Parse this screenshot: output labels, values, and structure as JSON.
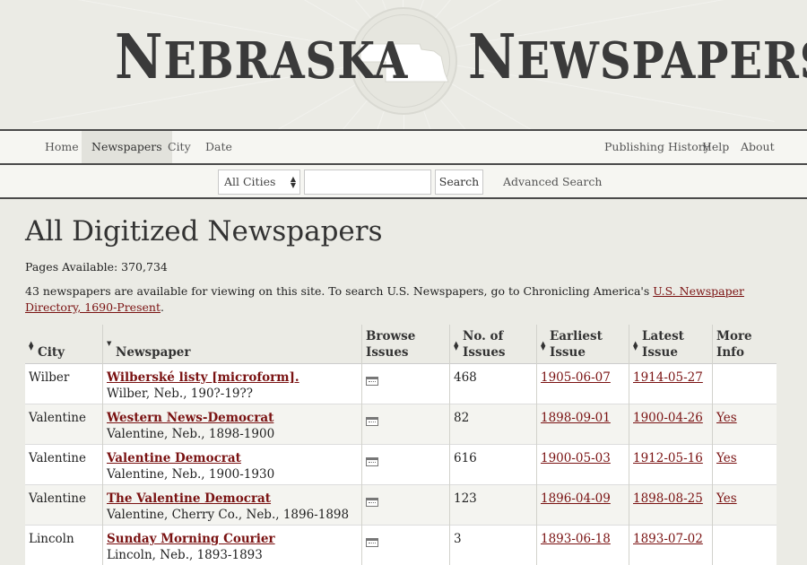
{
  "header": {
    "title_left_initial": "N",
    "title_left_rest": "EBRASKA",
    "title_right_initial": "N",
    "title_right_rest": "EWSPAPERS"
  },
  "nav": {
    "left": [
      "Home",
      "Newspapers",
      "City",
      "Date"
    ],
    "right": [
      "Publishing History",
      "Help",
      "About"
    ],
    "active": "Newspapers"
  },
  "search": {
    "city_select": "All Cities",
    "input_value": "",
    "button_label": "Search",
    "advanced_label": "Advanced Search"
  },
  "page": {
    "heading": "All Digitized Newspapers",
    "pages_available": "Pages Available: 370,734",
    "intro_text": "43 newspapers are available for viewing on this site. To search U.S. Newspapers, go to Chronicling America's ",
    "intro_link": "U.S. Newspaper Directory, 1690-Present",
    "intro_end": "."
  },
  "table": {
    "headers": {
      "city": "City",
      "newspaper": "Newspaper",
      "browse_1": "Browse",
      "browse_2": "Issues",
      "issues_1": "No. of",
      "issues_2": "Issues",
      "earliest_1": "Earliest",
      "earliest_2": "Issue",
      "latest_1": "Latest",
      "latest_2": "Issue",
      "more_1": "More",
      "more_2": "Info"
    },
    "rows": [
      {
        "city": "Wilber",
        "title": "Wilberské listy [microform].",
        "place": "Wilber, Neb., 190?-19??",
        "issues": "468",
        "earliest": "1905-06-07",
        "latest": "1914-05-27",
        "more": ""
      },
      {
        "city": "Valentine",
        "title": "Western News-Democrat",
        "place": "Valentine, Neb., 1898-1900",
        "issues": "82",
        "earliest": "1898-09-01",
        "latest": "1900-04-26",
        "more": "Yes"
      },
      {
        "city": "Valentine",
        "title": "Valentine Democrat",
        "place": "Valentine, Neb., 1900-1930",
        "issues": "616",
        "earliest": "1900-05-03",
        "latest": "1912-05-16",
        "more": "Yes"
      },
      {
        "city": "Valentine",
        "title": "The Valentine Democrat",
        "place": "Valentine, Cherry Co., Neb., 1896-1898",
        "issues": "123",
        "earliest": "1896-04-09",
        "latest": "1898-08-25",
        "more": "Yes"
      },
      {
        "city": "Lincoln",
        "title": "Sunday Morning Courier",
        "place": "Lincoln, Neb., 1893-1893",
        "issues": "3",
        "earliest": "1893-06-18",
        "latest": "1893-07-02",
        "more": ""
      }
    ]
  },
  "colors": {
    "link": "#7a1212",
    "background": "#ebebe5",
    "nav_border": "#4a4a4a"
  }
}
